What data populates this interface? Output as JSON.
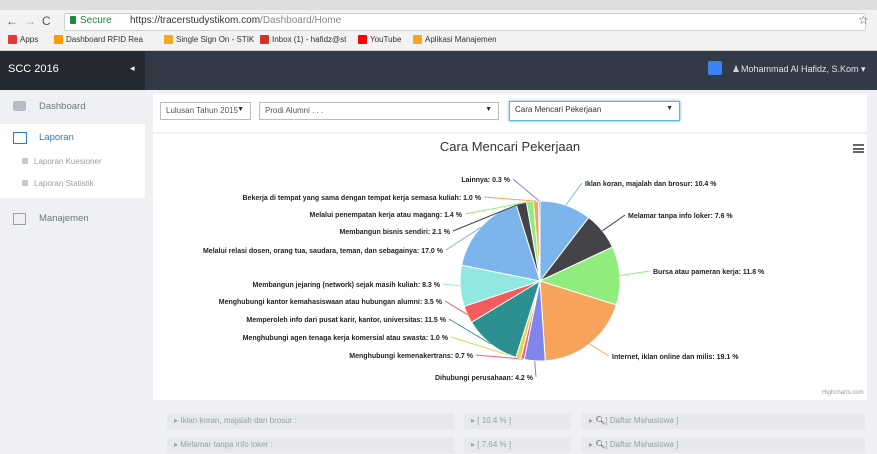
{
  "browser": {
    "secure_label": "Secure",
    "url_host": "https://tracerstudystikom.com",
    "url_path": "/Dashboard/Home",
    "bookmarks": [
      {
        "label": "Apps",
        "icon": "apps-icon",
        "color": "#e53935"
      },
      {
        "label": "Dashboard RFID Rea",
        "icon": "orange-square-icon",
        "color": "#ff9800"
      },
      {
        "label": "Single Sign On - STIK",
        "icon": "stikom-logo-icon",
        "color": "#f5a623"
      },
      {
        "label": "Inbox (1) - hafidz@st",
        "icon": "gmail-icon",
        "color": "#d93025"
      },
      {
        "label": "YouTube",
        "icon": "youtube-icon",
        "color": "#ff0000"
      },
      {
        "label": "Aplikasi Manajemen",
        "icon": "stikom-logo-icon",
        "color": "#f5a623"
      }
    ]
  },
  "header": {
    "brand": "SCC 2016",
    "user_name": "Mohammad Al Hafidz, S.Kom",
    "accent": "#3b82f6",
    "bar_color": "#313a46"
  },
  "sidebar": {
    "items": [
      {
        "label": "Dashboard",
        "icon": "dashboard-icon"
      },
      {
        "label": "Laporan",
        "icon": "bar-chart-icon",
        "active": true
      },
      {
        "label": "Laporan Kuesioner",
        "icon": "document-icon"
      },
      {
        "label": "Laporan Statistik",
        "icon": "document-icon"
      },
      {
        "label": "Manajemen",
        "icon": "table-icon"
      }
    ]
  },
  "filters": {
    "year": "Lulusan Tahun 2015",
    "prodi": "Prodi Alumni . . .",
    "topic": "Cara Mencari Pekerjaan"
  },
  "chart_data": {
    "type": "pie",
    "title": "Cara Mencari Pekerjaan",
    "slices": [
      {
        "label": "Iklan koran, majalah dan brosur",
        "value": 10.4,
        "color": "#7cb5ec"
      },
      {
        "label": "Melamar tanpa info loker",
        "value": 7.6,
        "color": "#434348"
      },
      {
        "label": "Bursa atau pameran kerja",
        "value": 11.8,
        "color": "#90ed7d"
      },
      {
        "label": "Internet, iklan online dan milis",
        "value": 19.1,
        "color": "#f7a35c"
      },
      {
        "label": "Dihubungi perusahaan",
        "value": 4.2,
        "color": "#8085e9"
      },
      {
        "label": "Menghubungi kemenakertrans",
        "value": 0.7,
        "color": "#f15c80"
      },
      {
        "label": "Menghubungi agen tenaga kerja komersial atau swasta",
        "value": 1.0,
        "color": "#e4d354"
      },
      {
        "label": "Memperoleh info dari pusat karir, kantor, universitas",
        "value": 11.5,
        "color": "#2b908f"
      },
      {
        "label": "Menghubungi kantor kemahasiswaan atau hubungan alumni",
        "value": 3.5,
        "color": "#f45b5b"
      },
      {
        "label": "Membangun jejaring (network) sejak masih kuliah",
        "value": 8.3,
        "color": "#91e8e1"
      },
      {
        "label": "Melalui relasi dosen, orang tua, saudara, teman, dan sebagainya",
        "value": 17.0,
        "color": "#7cb5ec"
      },
      {
        "label": "Membangun bisnis sendiri",
        "value": 2.1,
        "color": "#434348"
      },
      {
        "label": "Melalui penempatan kerja atau magang",
        "value": 1.4,
        "color": "#90ed7d"
      },
      {
        "label": "Bekerja di tempat yang sama dengan tempat kerja semasa kuliah",
        "value": 1.0,
        "color": "#f7a35c"
      },
      {
        "label": "Lainnya",
        "value": 0.3,
        "color": "#8085e9"
      }
    ],
    "data_labels": [
      "Iklan koran, majalah dan brosur: 10.4 %",
      "Melamar tanpa info loker: 7.6 %",
      "Bursa atau pameran kerja: 11.8 %",
      "Internet, iklan online dan milis: 19.1 %",
      "Dihubungi perusahaan: 4.2 %",
      "Menghubungi kemenakertrans: 0.7 %",
      "Menghubungi agen tenaga kerja komersial atau swasta: 1.0 %",
      "Memperoleh info dari pusat karir, kantor, universitas: 11.5 %",
      "Menghubungi kantor kemahasiswaan atau hubungan alumni: 3.5 %",
      "Membangun jejaring (network) sejak masih kuliah: 8.3 %",
      "Melalui relasi dosen, orang tua, saudara, teman, dan sebagainya: 17.0 %",
      "Membangun bisnis sendiri: 2.1 %",
      "Melalui penempatan kerja atau magang: 1.4 %",
      "Bekerja di tempat yang sama dengan tempat kerja semasa kuliah: 1.0 %",
      "Lainnya: 0.3 %"
    ],
    "credits": "Highcharts.com"
  },
  "table": {
    "rows": [
      {
        "label": "Iklan koran, majalah dan brosur :",
        "value": "[ 10.4 % ]",
        "action": "[ Daftar Mahasiswa ]"
      },
      {
        "label": "Melamar tanpa info loker :",
        "value": "[ 7.64 % ]",
        "action": "[ Daftar Mahasiswa ]"
      }
    ]
  }
}
